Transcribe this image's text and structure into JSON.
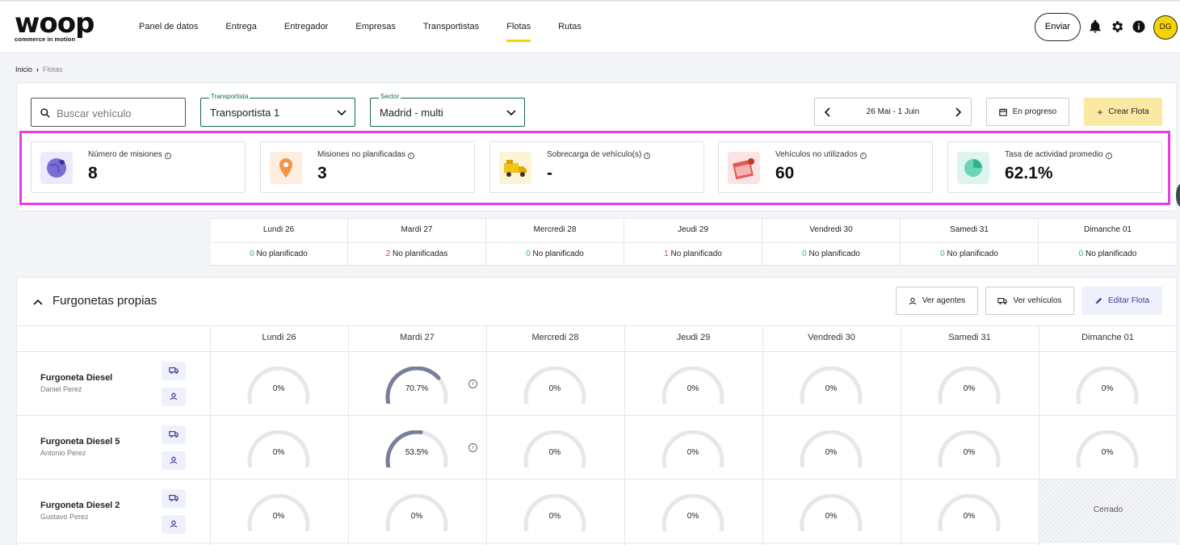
{
  "brand": {
    "name": "woop",
    "tagline": "commerce in motion"
  },
  "nav": [
    {
      "label": "Panel de datos"
    },
    {
      "label": "Entrega"
    },
    {
      "label": "Entregador"
    },
    {
      "label": "Empresas"
    },
    {
      "label": "Transportistas"
    },
    {
      "label": "Flotas",
      "active": true
    },
    {
      "label": "Rutas"
    }
  ],
  "header": {
    "send_label": "Enviar",
    "avatar_initials": "DG",
    "icons": [
      "bell-icon",
      "gear-icon",
      "info-icon"
    ]
  },
  "breadcrumb": {
    "home": "Inicio",
    "current": "Flotas"
  },
  "filters": {
    "search_placeholder": "Buscar vehículo",
    "carrier_label": "Transportista",
    "carrier_value": "Transportista 1",
    "sector_label": "Sector",
    "sector_value": "Madrid - multi",
    "date_range": "26 Mai - 1 Juin",
    "status_label": "En progreso",
    "create_label": "Crear Flota"
  },
  "kpis": [
    {
      "title": "Número de misiones",
      "value": "8",
      "icon": "globe-icon"
    },
    {
      "title": "Misiones no planificadas",
      "value": "3",
      "icon": "map-pin-icon"
    },
    {
      "title": "Sobrecarga de vehículo(s)",
      "value": "-",
      "icon": "truck-overload-icon"
    },
    {
      "title": "Vehículos no utilizados",
      "value": "60",
      "icon": "calendar-unused-icon"
    },
    {
      "title": "Tasa de actividad promedio",
      "value": "62.1%",
      "icon": "pie-chart-icon"
    }
  ],
  "days": [
    "Lundi 26",
    "Mardi 27",
    "Mercredi 28",
    "Jeudi 29",
    "Vendredi 30",
    "Samedi 31",
    "Dimanche 01"
  ],
  "unplanned": [
    {
      "count": "0",
      "label": "No planificado",
      "color": "#2bb673"
    },
    {
      "count": "2",
      "label": "No planificadas",
      "color": "#e03a3a"
    },
    {
      "count": "0",
      "label": "No planificado",
      "color": "#2bb673"
    },
    {
      "count": "1",
      "label": "No planificado",
      "color": "#e03a3a"
    },
    {
      "count": "0",
      "label": "No planificado",
      "color": "#2bb673"
    },
    {
      "count": "0",
      "label": "No planificado",
      "color": "#2bb673"
    },
    {
      "count": "0",
      "label": "No planificado",
      "color": "#2bb673"
    }
  ],
  "fleet": {
    "title": "Furgonetas propias",
    "buttons": {
      "agents": "Ver agentes",
      "vehicles": "Ver vehículos",
      "edit": "Editar Flota"
    },
    "vehicles": [
      {
        "name": "Furgoneta Diesel",
        "driver": "Daniel Perez",
        "usage": [
          "0%",
          "70.7%",
          "0%",
          "0%",
          "0%",
          "0%",
          "0%"
        ],
        "fractions": [
          0,
          0.707,
          0,
          0,
          0,
          0,
          0
        ]
      },
      {
        "name": "Furgoneta Diesel 5",
        "driver": "Antonio Perez",
        "usage": [
          "0%",
          "53.5%",
          "0%",
          "0%",
          "0%",
          "0%",
          "0%"
        ],
        "fractions": [
          0,
          0.535,
          0,
          0,
          0,
          0,
          0
        ]
      },
      {
        "name": "Furgoneta Diesel 2",
        "driver": "Gustavo Perez",
        "usage": [
          "0%",
          "0%",
          "0%",
          "0%",
          "0%",
          "0%",
          "Cerrado"
        ],
        "fractions": [
          0,
          0,
          0,
          0,
          0,
          0,
          null
        ]
      }
    ]
  },
  "colors": {
    "accent": "#f5d400",
    "highlight": "#e93de6",
    "gauge_track": "#e6e7eb",
    "gauge_fill": "#7a7f98",
    "select_border": "#0f6b4f"
  }
}
